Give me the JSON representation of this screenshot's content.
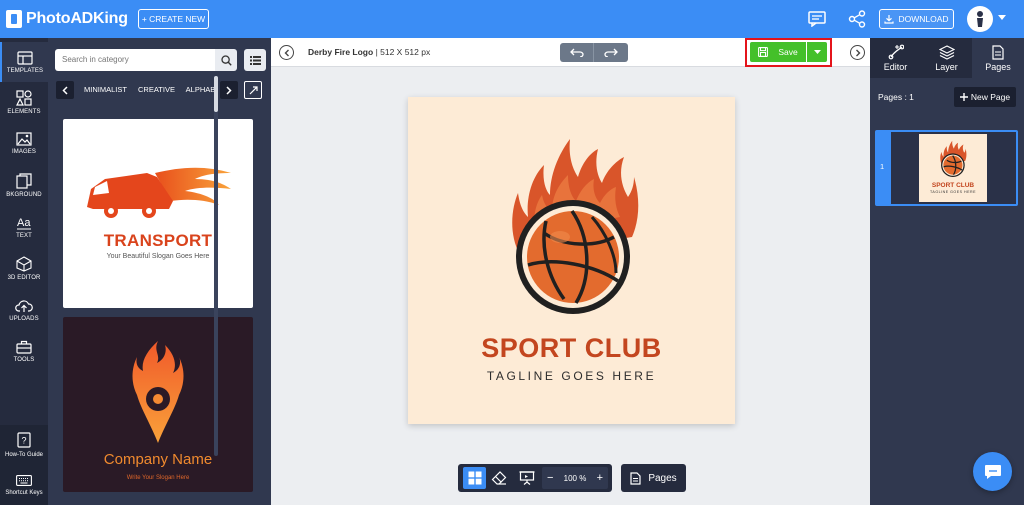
{
  "app": {
    "logo_text": "PhotoADKing",
    "create_new_label": "+ CREATE NEW",
    "download_label": "DOWNLOAD"
  },
  "rail": {
    "items": [
      {
        "label": "TEMPLATES",
        "icon": "templates-icon"
      },
      {
        "label": "ELEMENTS",
        "icon": "elements-icon"
      },
      {
        "label": "IMAGES",
        "icon": "images-icon"
      },
      {
        "label": "BKGROUND",
        "icon": "background-icon"
      },
      {
        "label": "TEXT",
        "icon": "text-icon"
      },
      {
        "label": "3D EDITOR",
        "icon": "3d-editor-icon"
      },
      {
        "label": "UPLOADS",
        "icon": "uploads-icon"
      },
      {
        "label": "TOOLS",
        "icon": "tools-icon"
      }
    ],
    "bottom": [
      {
        "label": "How-To Guide",
        "icon": "guide-icon"
      },
      {
        "label": "Shortcut Keys",
        "icon": "keyboard-icon"
      }
    ]
  },
  "panel": {
    "search_placeholder": "Search in category",
    "categories": [
      "MINIMALIST",
      "CREATIVE",
      "ALPHABET"
    ],
    "templates": [
      {
        "title": "TRANSPORT",
        "slogan": "Your Beautiful Slogan Goes Here"
      },
      {
        "title": "Company Name",
        "slogan": "Write Your Slogan Here"
      }
    ]
  },
  "editor": {
    "doc_name": "Derby Fire Logo",
    "doc_size": "| 512 X 512 px",
    "save_label": "Save",
    "artboard": {
      "title": "SPORT CLUB",
      "tagline": "TAGLINE GOES HERE",
      "bg_color": "#fdebd6",
      "accent_color": "#c3461f"
    },
    "zoom": "100 %",
    "zoom_minus": "−",
    "zoom_plus": "+",
    "pages_label": "Pages"
  },
  "rightpanel": {
    "tabs": [
      {
        "label": "Editor",
        "icon": "editor-icon"
      },
      {
        "label": "Layer",
        "icon": "layer-icon"
      },
      {
        "label": "Pages",
        "icon": "pages-icon"
      }
    ],
    "pages_count": "Pages : 1",
    "new_page_label": "New Page",
    "page_thumb_number": "1"
  },
  "colors": {
    "brand_blue": "#3b8df5",
    "save_green": "#44c02a",
    "highlight_red": "#e4141b",
    "dark_panel": "#252b3e"
  }
}
